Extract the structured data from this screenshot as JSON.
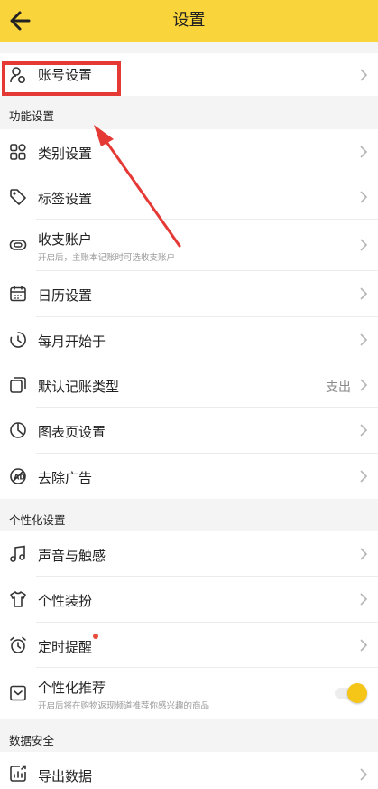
{
  "header": {
    "title": "设置"
  },
  "account": {
    "label": "账号设置"
  },
  "sections": {
    "function": "功能设置",
    "personal": "个性化设置",
    "data": "数据安全"
  },
  "items": {
    "category": "类别设置",
    "tag": "标签设置",
    "account_book": {
      "label": "收支账户",
      "sub": "开启后，主账本记账时可选收支账户"
    },
    "calendar": "日历设置",
    "month_start": "每月开始于",
    "default_type": {
      "label": "默认记账类型",
      "value": "支出"
    },
    "chart_page": "图表页设置",
    "remove_ads": "去除广告",
    "sound": "声音与触感",
    "theme": "个性装扮",
    "reminder": "定时提醒",
    "recommend": {
      "label": "个性化推荐",
      "sub": "开启后将在购物返现频道推荐你感兴趣的商品",
      "enabled": true
    },
    "export": "导出数据"
  },
  "colors": {
    "header": "#f9d43a",
    "toggle_knob": "#f5c518",
    "annotation": "#e53935",
    "badge": "#e74c3c"
  }
}
